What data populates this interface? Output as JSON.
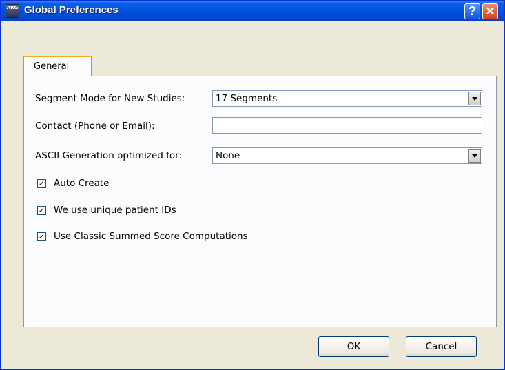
{
  "window": {
    "title": "Global Preferences",
    "icon_text": "ARG",
    "help_label": "?",
    "close_label": "✕"
  },
  "tabs": [
    {
      "label": "General"
    }
  ],
  "form": {
    "segment_mode": {
      "label": "Segment Mode for New Studies:",
      "value": "17 Segments"
    },
    "contact": {
      "label": "Contact (Phone or Email):",
      "value": ""
    },
    "ascii_generation": {
      "label": "ASCII Generation optimized for:",
      "value": "None"
    },
    "checkboxes": [
      {
        "label": "Auto Create",
        "checked": true,
        "mark": "✓"
      },
      {
        "label": "We use unique patient IDs",
        "checked": true,
        "mark": "✓"
      },
      {
        "label": "Use Classic Summed Score Computations",
        "checked": true,
        "mark": "✓"
      }
    ]
  },
  "buttons": {
    "ok": "OK",
    "cancel": "Cancel"
  },
  "colors": {
    "titlebar": "#0054e3",
    "dialog_bg": "#ece9d8",
    "tab_accent": "#f5a623"
  }
}
